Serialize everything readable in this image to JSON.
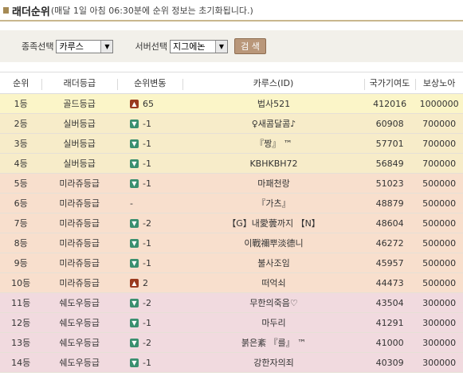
{
  "header": {
    "title": "래더순위",
    "note": "(매달 1일 아침 06:30분에 순위 정보는 초기화됩니다.)"
  },
  "filters": {
    "tribe_label": "종족선택",
    "tribe_value": "카루스",
    "server_label": "서버선택",
    "server_value": "지그에논",
    "search_label": "검 색"
  },
  "table": {
    "headers": [
      "순위",
      "래더등급",
      "순위변동",
      "카루스(ID)",
      "국가기여도",
      "보상노아"
    ],
    "rows": [
      {
        "rank": "1등",
        "grade": "골드등급",
        "dir": "up",
        "change": "65",
        "id": "법사521",
        "contribution": "412016",
        "reward": "1000000",
        "bg": "#fbf5c8"
      },
      {
        "rank": "2등",
        "grade": "실버등급",
        "dir": "down",
        "change": "-1",
        "id": "♀새콤달콤♪",
        "contribution": "60908",
        "reward": "700000",
        "bg": "#f7ecc9"
      },
      {
        "rank": "3등",
        "grade": "실버등급",
        "dir": "down",
        "change": "-1",
        "id": "『짱』 ™",
        "contribution": "57701",
        "reward": "700000",
        "bg": "#f7ecc9"
      },
      {
        "rank": "4등",
        "grade": "실버등급",
        "dir": "down",
        "change": "-1",
        "id": "KBHKBH72",
        "contribution": "56849",
        "reward": "700000",
        "bg": "#f7ecc9"
      },
      {
        "rank": "5등",
        "grade": "미라쥬등급",
        "dir": "down",
        "change": "-1",
        "id": "마패천랑",
        "contribution": "51023",
        "reward": "500000",
        "bg": "#f8dfcd"
      },
      {
        "rank": "6등",
        "grade": "미라쥬등급",
        "dir": "none",
        "change": "-",
        "id": "『가츠』",
        "contribution": "48879",
        "reward": "500000",
        "bg": "#f8dfcd"
      },
      {
        "rank": "7등",
        "grade": "미라쥬등급",
        "dir": "down",
        "change": "-2",
        "id": "【G】내愛蕓까지 【N】",
        "contribution": "48604",
        "reward": "500000",
        "bg": "#f8dfcd"
      },
      {
        "rank": "8등",
        "grade": "미라쥬등급",
        "dir": "down",
        "change": "-1",
        "id": "이戰禰뿌淡德니",
        "contribution": "46272",
        "reward": "500000",
        "bg": "#f8dfcd"
      },
      {
        "rank": "9등",
        "grade": "미라쥬등급",
        "dir": "down",
        "change": "-1",
        "id": "불사조임",
        "contribution": "45957",
        "reward": "500000",
        "bg": "#f8dfcd"
      },
      {
        "rank": "10등",
        "grade": "미라쥬등급",
        "dir": "up",
        "change": "2",
        "id": "떠억쇠",
        "contribution": "44473",
        "reward": "500000",
        "bg": "#f8dfcd"
      },
      {
        "rank": "11등",
        "grade": "쉐도우등급",
        "dir": "down",
        "change": "-2",
        "id": "무한의죽음♡",
        "contribution": "43504",
        "reward": "300000",
        "bg": "#f1dadf"
      },
      {
        "rank": "12등",
        "grade": "쉐도우등급",
        "dir": "down",
        "change": "-1",
        "id": "마두리",
        "contribution": "41291",
        "reward": "300000",
        "bg": "#f1dadf"
      },
      {
        "rank": "13등",
        "grade": "쉐도우등급",
        "dir": "down",
        "change": "-2",
        "id": "붉은紊 『를』 ™",
        "contribution": "41000",
        "reward": "300000",
        "bg": "#f1dadf"
      },
      {
        "rank": "14등",
        "grade": "쉐도우등급",
        "dir": "down",
        "change": "-1",
        "id": "강한자의죄",
        "contribution": "40309",
        "reward": "300000",
        "bg": "#f1dadf"
      }
    ]
  },
  "icons": {
    "up": "arrow-up-icon",
    "down": "arrow-down-icon"
  }
}
